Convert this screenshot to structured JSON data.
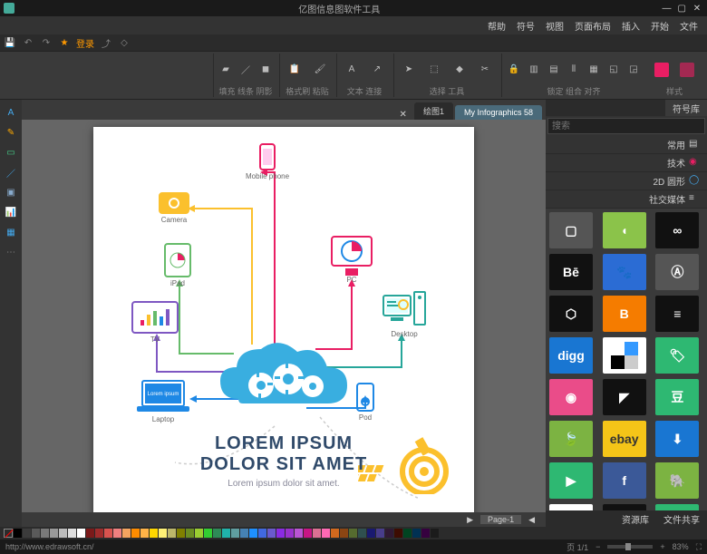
{
  "app": {
    "title": "亿图信息图软件工具"
  },
  "menu": [
    "文件",
    "开始",
    "插入",
    "页面布局",
    "视图",
    "符号",
    "帮助"
  ],
  "quick": {
    "label": "登录"
  },
  "ribbon": {
    "groups": [
      {
        "label": "样式",
        "items": [
          "paint1",
          "paint2"
        ]
      },
      {
        "label": "锁定 组合 对齐",
        "items": [
          "lock",
          "ungroup",
          "align",
          "distribute",
          "group",
          "front",
          "back"
        ]
      },
      {
        "label": "选择 工具",
        "items": [
          "pointer",
          "select",
          "node",
          "crop"
        ]
      },
      {
        "label": "文本 连接",
        "items": [
          "text",
          "connector"
        ]
      },
      {
        "label": "格式刷 粘贴",
        "items": [
          "paste",
          "brush"
        ]
      },
      {
        "label": "填充 线条 阴影",
        "items": [
          "fill",
          "line",
          "shadow"
        ]
      }
    ]
  },
  "doctabs": [
    {
      "label": "My Infographics 58",
      "active": true
    },
    {
      "label": "绘图1",
      "active": false
    }
  ],
  "rightpanel": {
    "tabs": [
      "符号库"
    ],
    "search_placeholder": "搜索",
    "categories": [
      "常用",
      "技术",
      "2D 圆形",
      "社交媒体"
    ],
    "footer": [
      "文件共享",
      "资源库"
    ]
  },
  "icons": [
    {
      "name": "apple",
      "bg": "#555555",
      "fg": "#ffffff"
    },
    {
      "name": "android",
      "bg": "#8bc34a",
      "fg": "#ffffff"
    },
    {
      "name": "infinity",
      "bg": "#111111",
      "fg": "#ffffff"
    },
    {
      "name": "behance",
      "bg": "#111111",
      "fg": "#ffffff"
    },
    {
      "name": "baidu",
      "bg": "#2b6cd4",
      "fg": "#ffffff"
    },
    {
      "name": "appstore",
      "bg": "#555555",
      "fg": "#ffffff"
    },
    {
      "name": "codepen",
      "bg": "#111111",
      "fg": "#ffffff"
    },
    {
      "name": "blogger",
      "bg": "#f57c00",
      "fg": "#ffffff"
    },
    {
      "name": "stack",
      "bg": "#111111",
      "fg": "#ffffff"
    },
    {
      "name": "digg",
      "bg": "#1976d2",
      "fg": "#ffffff"
    },
    {
      "name": "delicious",
      "bg": "#ffffff",
      "fg": "#000000"
    },
    {
      "name": "tag",
      "bg": "#2eb872",
      "fg": "#ffffff"
    },
    {
      "name": "dribbble",
      "bg": "#ea4c89",
      "fg": "#ffffff"
    },
    {
      "name": "deviant",
      "bg": "#111111",
      "fg": "#ffffff"
    },
    {
      "name": "douban",
      "bg": "#2eb872",
      "fg": "#ffffff"
    },
    {
      "name": "envato",
      "bg": "#7cb342",
      "fg": "#ffffff"
    },
    {
      "name": "ebay",
      "bg": "#f5c518",
      "fg": "#333333"
    },
    {
      "name": "dropbox",
      "bg": "#1976d2",
      "fg": "#ffffff"
    },
    {
      "name": "video",
      "bg": "#2eb872",
      "fg": "#ffffff"
    },
    {
      "name": "facebook",
      "bg": "#3b5998",
      "fg": "#ffffff"
    },
    {
      "name": "evernote",
      "bg": "#7cb342",
      "fg": "#ffffff"
    },
    {
      "name": "gmail",
      "bg": "#ffffff",
      "fg": "#d32f2f"
    },
    {
      "name": "flickr",
      "bg": "#111111",
      "fg": "#ffffff"
    },
    {
      "name": "forrst",
      "bg": "#2eb872",
      "fg": "#ffffff"
    }
  ],
  "pagetabs": [
    "Page-1"
  ],
  "infographic": {
    "title_line1": "LOREM IPSUM",
    "title_line2": "DOLOR SIT AMET",
    "subtitle": "Lorem ipsum dolor sit amet.",
    "devices": [
      {
        "name": "Mobile phone",
        "color": "#e91e63"
      },
      {
        "name": "Camera",
        "color": "#fbc02d"
      },
      {
        "name": "iPad",
        "color": "#66bb6a"
      },
      {
        "name": "TV",
        "color": "#7e57c2"
      },
      {
        "name": "Laptop",
        "color": "#1e88e5"
      },
      {
        "name": "PC",
        "color": "#e91e63"
      },
      {
        "name": "Desktop",
        "color": "#26a69a"
      },
      {
        "name": "Pod",
        "color": "#1e88e5"
      }
    ],
    "laptop_text": "Lorem ipsum"
  },
  "colors": [
    "#000000",
    "#3b3b3b",
    "#5a5a5a",
    "#7a7a7a",
    "#9a9a9a",
    "#bcbcbc",
    "#dedede",
    "#ffffff",
    "#7b1a1a",
    "#a02c2c",
    "#d9534f",
    "#f08080",
    "#f4a460",
    "#ff8c00",
    "#ffb347",
    "#ffd700",
    "#fff176",
    "#bdb76b",
    "#808000",
    "#6b8e23",
    "#9acd32",
    "#32cd32",
    "#2e8b57",
    "#20b2aa",
    "#5f9ea0",
    "#4682b4",
    "#1e90ff",
    "#4169e1",
    "#6a5acd",
    "#8a2be2",
    "#9932cc",
    "#ba55d3",
    "#c71585",
    "#db7093",
    "#ff69b4",
    "#d2691e",
    "#8b4513",
    "#556b2f",
    "#2f4f4f",
    "#191970",
    "#483d8b",
    "#301934",
    "#3d0c02",
    "#014421",
    "#003153",
    "#36013f",
    "#1b1b1b"
  ],
  "status": {
    "left": "http://www.edrawsoft.cn/",
    "page": "页 1/1",
    "zoom": "83%"
  }
}
